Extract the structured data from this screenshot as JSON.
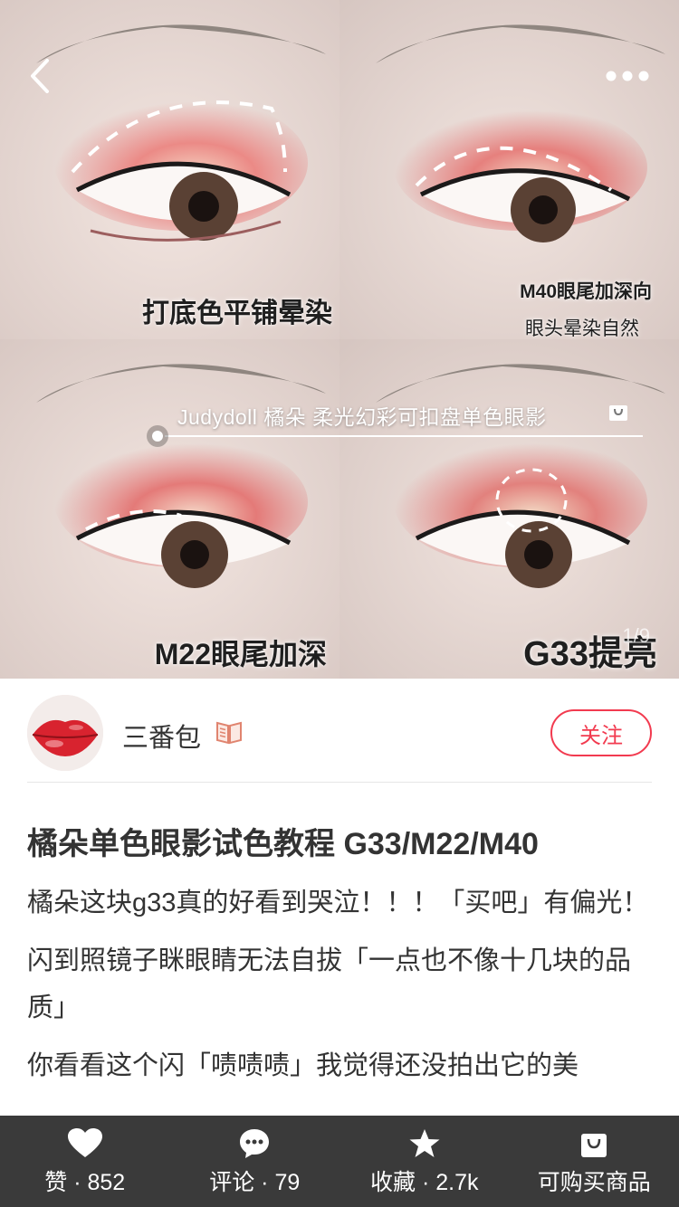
{
  "post": {
    "images": {
      "panels": [
        {
          "caption_lines": [
            "打底色平铺晕染"
          ]
        },
        {
          "caption_lines": [
            "M40眼尾加深向",
            "眼头晕染自然"
          ]
        },
        {
          "caption_lines": [
            "M22眼尾加深"
          ]
        },
        {
          "caption_lines": [
            "G33提亮"
          ]
        }
      ],
      "product_tag": "Judydoll 橘朵 柔光幻彩可扣盘单色眼影",
      "page_indicator": "1/9"
    },
    "author": {
      "name": "三番包",
      "badge_icon": "book-icon"
    },
    "follow_label": "关注",
    "title": "橘朵单色眼影试色教程 G33/M22/M40",
    "body": [
      "橘朵这块g33真的好看到哭泣！！！「买吧」有偏光！",
      "闪到照镜子眯眼睛无法自拔「一点也不像十几块的品质」",
      "你看看这个闪「啧啧啧」我觉得还没拍出它的美"
    ]
  },
  "bottom_bar": {
    "like": {
      "label": "赞 · 852",
      "icon": "heart-icon"
    },
    "comment": {
      "label": "评论 · 79",
      "icon": "comment-icon"
    },
    "collect": {
      "label": "收藏 · 2.7k",
      "icon": "star-icon"
    },
    "shop": {
      "label": "可购买商品",
      "icon": "shopping-bag-icon"
    }
  },
  "colors": {
    "accent": "#f23a4f",
    "bottom_bar": "#3a3a3a"
  }
}
